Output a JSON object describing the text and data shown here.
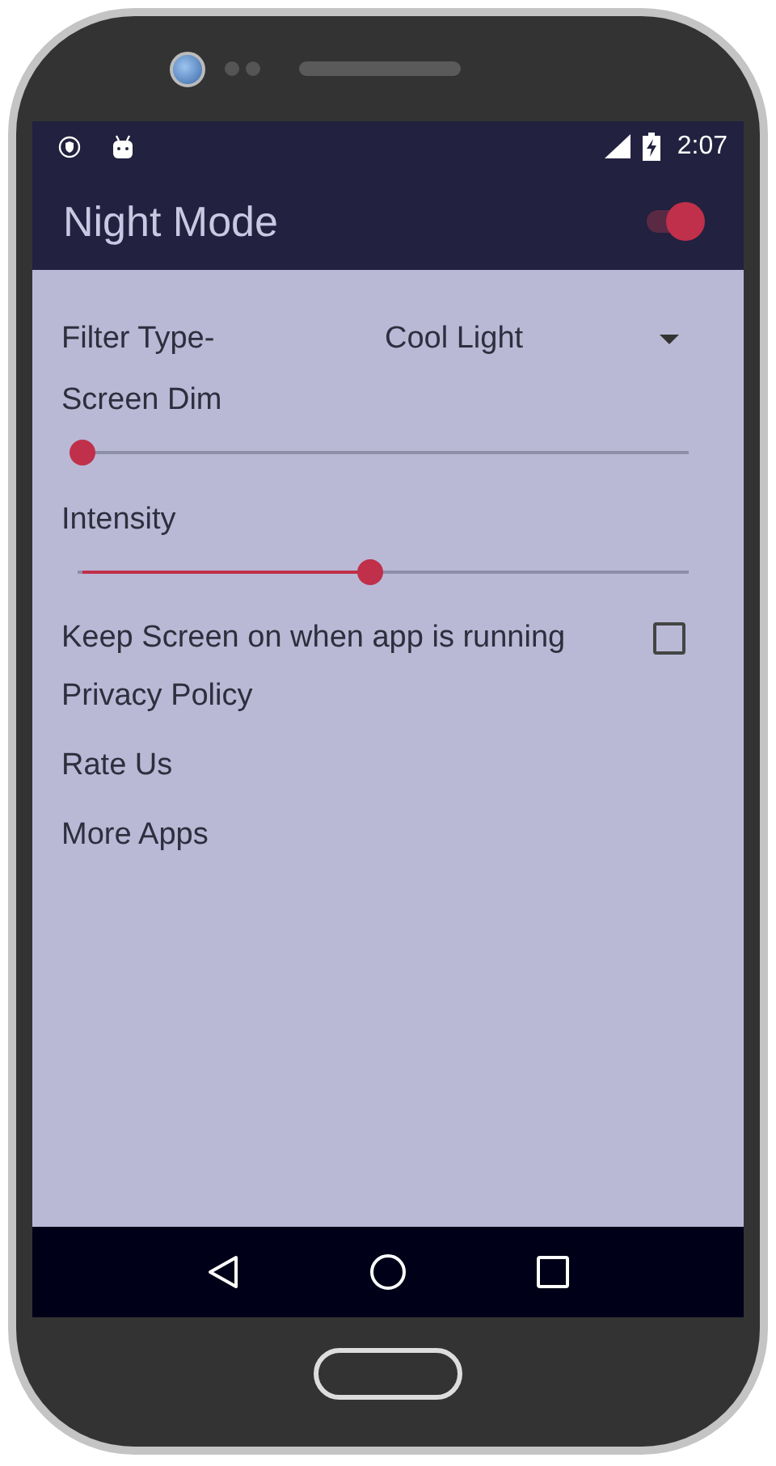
{
  "status_bar": {
    "time": "2:07"
  },
  "app_bar": {
    "title": "Night Mode",
    "toggle_on": true
  },
  "filter": {
    "label": "Filter Type-",
    "value": "Cool Light"
  },
  "sliders": [
    {
      "label": "Screen Dim",
      "level": 0
    },
    {
      "label": "Intensity",
      "level": 0.47
    }
  ],
  "keep_screen_on": {
    "label": "Keep Screen on when app is running",
    "checked": false
  },
  "links": [
    "Privacy Policy",
    "Rate Us",
    "More Apps"
  ]
}
